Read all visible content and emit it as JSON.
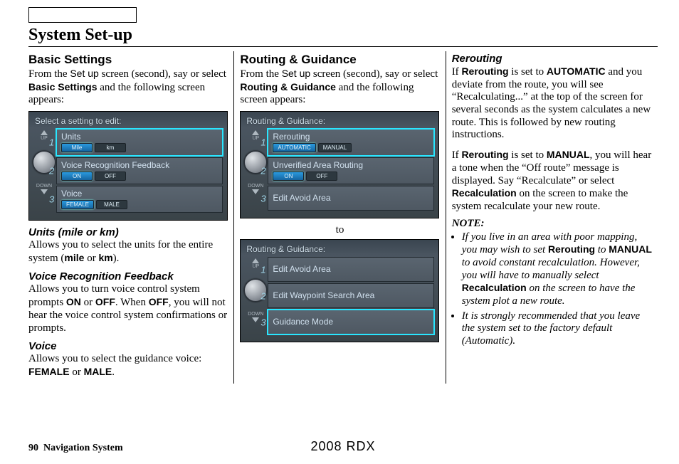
{
  "page_title": "System Set-up",
  "page_number": "90",
  "footer_section": "Navigation System",
  "footer_model": "2008  RDX",
  "col1": {
    "heading": "Basic Settings",
    "intro_prefix": "From the ",
    "intro_setup": "Set up",
    "intro_mid": " screen (second), say or select ",
    "intro_bold": "Basic Settings",
    "intro_suffix": " and the following screen appears:",
    "panel": {
      "title": "Select a setting to edit:",
      "items": [
        {
          "label": "Units",
          "options": [
            "Mile",
            "km"
          ],
          "active": 0
        },
        {
          "label": "Voice Recognition Feedback",
          "options": [
            "ON",
            "OFF"
          ],
          "active": 0
        },
        {
          "label": "Voice",
          "options": [
            "FEMALE",
            "MALE"
          ],
          "active": 0
        }
      ]
    },
    "sub1_head": "Units (mile or km)",
    "sub1_body_a": "Allows you to select the units for the entire system (",
    "sub1_body_b": "mile",
    "sub1_body_c": " or ",
    "sub1_body_d": "km",
    "sub1_body_e": ").",
    "sub2_head": "Voice Recognition Feedback",
    "sub2_body_a": "Allows you to turn voice control system prompts ",
    "sub2_body_b": "ON",
    "sub2_body_c": " or ",
    "sub2_body_d": "OFF",
    "sub2_body_e": ". When ",
    "sub2_body_f": "OFF",
    "sub2_body_g": ", you will not hear the voice control system confirmations or prompts.",
    "sub3_head": "Voice",
    "sub3_body_a": "Allows you to select the guidance voice: ",
    "sub3_body_b": "FEMALE",
    "sub3_body_c": " or ",
    "sub3_body_d": "MALE",
    "sub3_body_e": "."
  },
  "col2": {
    "heading": "Routing & Guidance",
    "intro_prefix": "From the ",
    "intro_setup": "Set up",
    "intro_mid": " screen (second), say or select ",
    "intro_bold": "Routing & Guidance",
    "intro_suffix": " and the following screen appears:",
    "panel1": {
      "title": "Routing & Guidance:",
      "items": [
        {
          "label": "Rerouting",
          "options": [
            "AUTOMATIC",
            "MANUAL"
          ],
          "active": 0
        },
        {
          "label": "Unverified Area Routing",
          "options": [
            "ON",
            "OFF"
          ],
          "active": 0
        },
        {
          "label": "Edit Avoid Area"
        }
      ]
    },
    "to": "to",
    "panel2": {
      "title": "Routing & Guidance:",
      "items": [
        {
          "label": "Edit Avoid Area"
        },
        {
          "label": "Edit Waypoint Search Area"
        },
        {
          "label": "Guidance Mode"
        }
      ]
    }
  },
  "col3": {
    "heading": "Rerouting",
    "p1_a": "If ",
    "p1_b": "Rerouting",
    "p1_c": " is set to ",
    "p1_d": "AUTOMATIC",
    "p1_e": " and you deviate from the route, you will see “Recalculating...” at the top of the screen for several seconds as the system calculates a new route. This is followed by new routing instructions.",
    "p2_a": "If ",
    "p2_b": "Rerouting",
    "p2_c": " is set to ",
    "p2_d": "MANUAL",
    "p2_e": ", you will hear a tone when the “Off route” message is displayed. Say “Recalculate” or select ",
    "p2_f": "Recalculation",
    "p2_g": " on the screen to make the system recalculate your new route.",
    "note_head": "NOTE:",
    "n1_a": "If you live in an area with poor mapping, you may wish to set ",
    "n1_b": "Rerouting",
    "n1_c": " to ",
    "n1_d": "MANUAL",
    "n1_e": " to avoid constant recalculation. However, you will have to manually select ",
    "n1_f": "Recalculation",
    "n1_g": " on the screen to have the system plot a new route.",
    "n2": "It is strongly recommended that you leave the system set to the factory default (Automatic)."
  }
}
